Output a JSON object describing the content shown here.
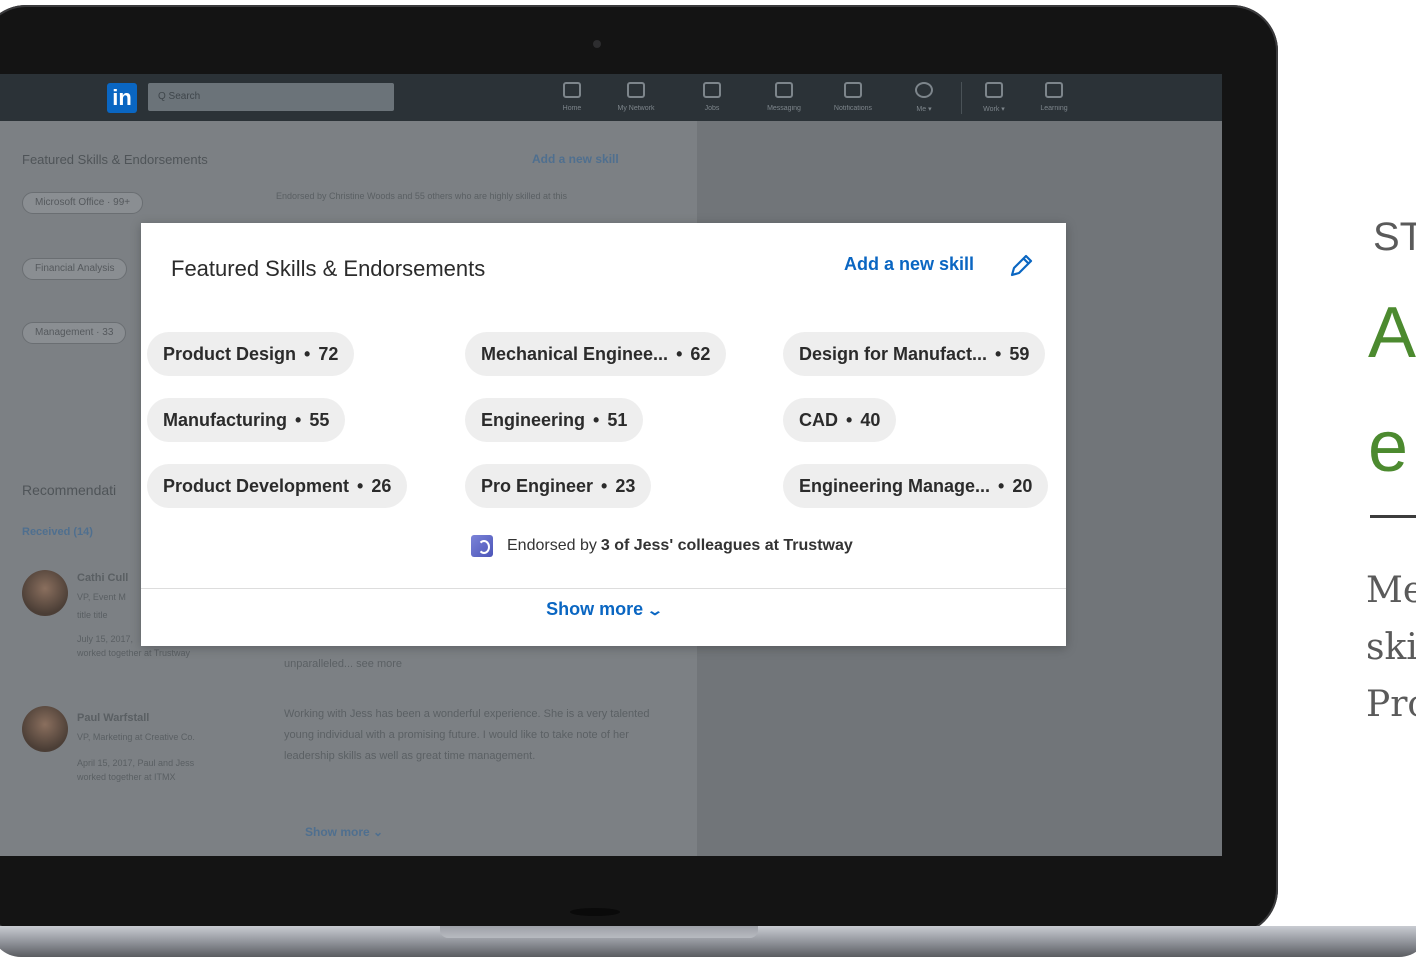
{
  "nav": {
    "logo": "in",
    "search_placeholder": "Q Search",
    "items": [
      {
        "label": "Home",
        "icon": "home-icon"
      },
      {
        "label": "My Network",
        "icon": "network-icon"
      },
      {
        "label": "Jobs",
        "icon": "briefcase-icon"
      },
      {
        "label": "Messaging",
        "icon": "messaging-icon"
      },
      {
        "label": "Notifications",
        "icon": "bell-icon"
      },
      {
        "label": "Me ▾",
        "icon": "avatar-icon"
      },
      {
        "label": "Work ▾",
        "icon": "grid-icon"
      },
      {
        "label": "Learning",
        "icon": "play-icon"
      }
    ]
  },
  "background": {
    "card_title": "Featured Skills & Endorsements",
    "add_skill": "Add a new skill",
    "pills": [
      "Microsoft Office · 99+",
      "Financial Analysis",
      "Management · 33"
    ],
    "endorsement_text": "Endorsed by Christine Woods and 55 others who are highly skilled at this",
    "recommendations_title": "Recommendati",
    "received_tab": "Received (14)",
    "recommendations": [
      {
        "name": "Cathi Cull",
        "title": "VP, Event M",
        "subtitle": "title title",
        "date": "July 15, 2017,",
        "relation": "worked together at Trustway",
        "quote": "unparalleled... see more"
      },
      {
        "name": "Paul Warfstall",
        "title": "VP, Marketing at Creative Co.",
        "date": "April 15, 2017, Paul and Jess",
        "relation": "worked together at ITMX",
        "quote": "Working with Jess has been a wonderful experience. She is a very talented young individual with a promising future. I would like to take note of her leadership skills as well as great time management."
      }
    ],
    "show_more": "Show more ⌄"
  },
  "modal": {
    "title": "Featured Skills & Endorsements",
    "add_skill": "Add a new skill",
    "skills": [
      {
        "name": "Product Design",
        "count": "72"
      },
      {
        "name": "Mechanical Enginee...",
        "count": "62"
      },
      {
        "name": "Design for Manufact...",
        "count": "59"
      },
      {
        "name": "Manufacturing",
        "count": "55"
      },
      {
        "name": "Engineering",
        "count": "51"
      },
      {
        "name": "CAD",
        "count": "40"
      },
      {
        "name": "Product Development",
        "count": "26"
      },
      {
        "name": "Pro Engineer",
        "count": "23"
      },
      {
        "name": "Engineering Manage...",
        "count": "20"
      }
    ],
    "endorsed_prefix": "Endorsed by",
    "endorsed_bold": "3 of Jess' colleagues at Trustway",
    "show_more": "Show more"
  },
  "side": {
    "step": "ST",
    "headline_1": "A",
    "headline_2": "e",
    "body_1": "Me",
    "body_2": "ski",
    "body_3": "Pro"
  },
  "colors": {
    "accent": "#0a66c2",
    "headline_green": "#4c8a2f",
    "chip_bg": "#eeeeee"
  }
}
